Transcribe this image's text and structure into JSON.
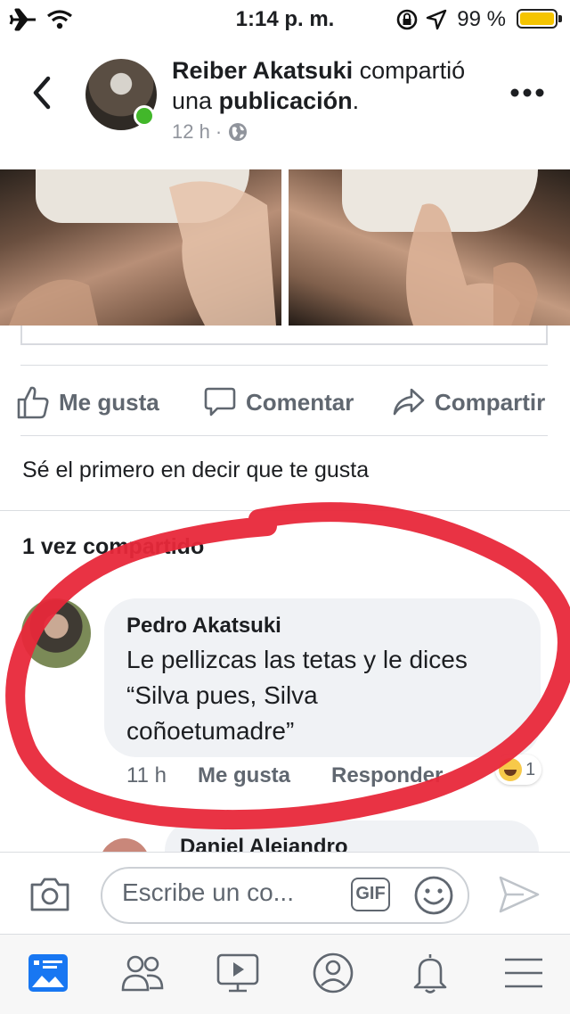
{
  "status_bar": {
    "time": "1:14 p. m.",
    "battery_pct": "99 %",
    "battery_level": 0.99,
    "battery_color": "#f5c400"
  },
  "header": {
    "author": "Reiber Akatsuki",
    "action": "compartió una",
    "object": "publicación",
    "suffix": ".",
    "age": "12 h",
    "separator": "·",
    "icons": {
      "back": "chevron-left-icon",
      "privacy": "globe-icon",
      "more": "more-dots-icon"
    }
  },
  "actions": {
    "like": "Me gusta",
    "comment": "Comentar",
    "share": "Compartir"
  },
  "first_like_prompt": "Sé el primero en decir que te gusta",
  "shares_count": "1 vez compartido",
  "comments": [
    {
      "name": "Pedro Akatsuki",
      "text": "Le pellizcas las tetas y le dices\n“Silva pues, Silva\ncoñoetumadre”",
      "age": "11 h",
      "like": "Me gusta",
      "reply": "Responder",
      "reaction_count": "1",
      "reaction_icon": "haha-emoji-icon"
    },
    {
      "name": "Daniel Alejandro"
    }
  ],
  "composer": {
    "placeholder": "Escribe un co...",
    "gif": "GIF"
  },
  "tabbar": [
    "news-feed-icon",
    "friends-icon",
    "watch-icon",
    "profile-icon",
    "notifications-icon",
    "menu-icon"
  ],
  "colors": {
    "accent": "#1877f2",
    "online": "#42b72a",
    "annotation_red": "#e8283a",
    "text_secondary": "#606770"
  }
}
